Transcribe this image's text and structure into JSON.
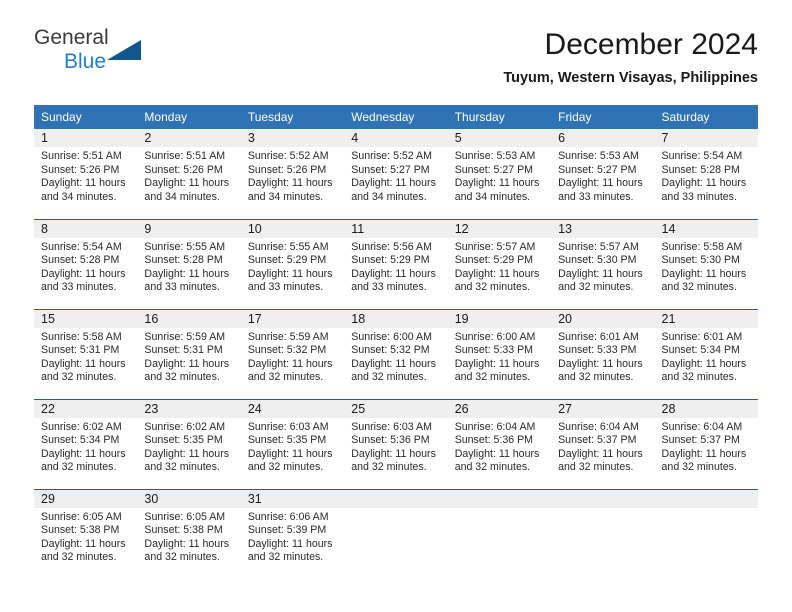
{
  "logo": {
    "word_top": "General",
    "word_bottom": "Blue",
    "triangle_color": "#11568f",
    "blue_color": "#1c7fd6"
  },
  "header": {
    "title": "December 2024",
    "subtitle": "Tuyum, Western Visayas, Philippines"
  },
  "theme": {
    "header_bg": "#2f73b4",
    "row_divider": "#1d5f9e",
    "daynum_bg": "#efefef"
  },
  "weekday_headers": [
    "Sunday",
    "Monday",
    "Tuesday",
    "Wednesday",
    "Thursday",
    "Friday",
    "Saturday"
  ],
  "weeks": [
    [
      {
        "day": "1",
        "sunrise": "Sunrise: 5:51 AM",
        "sunset": "Sunset: 5:26 PM",
        "daylight_line1": "Daylight: 11 hours",
        "daylight_line2": "and 34 minutes."
      },
      {
        "day": "2",
        "sunrise": "Sunrise: 5:51 AM",
        "sunset": "Sunset: 5:26 PM",
        "daylight_line1": "Daylight: 11 hours",
        "daylight_line2": "and 34 minutes."
      },
      {
        "day": "3",
        "sunrise": "Sunrise: 5:52 AM",
        "sunset": "Sunset: 5:26 PM",
        "daylight_line1": "Daylight: 11 hours",
        "daylight_line2": "and 34 minutes."
      },
      {
        "day": "4",
        "sunrise": "Sunrise: 5:52 AM",
        "sunset": "Sunset: 5:27 PM",
        "daylight_line1": "Daylight: 11 hours",
        "daylight_line2": "and 34 minutes."
      },
      {
        "day": "5",
        "sunrise": "Sunrise: 5:53 AM",
        "sunset": "Sunset: 5:27 PM",
        "daylight_line1": "Daylight: 11 hours",
        "daylight_line2": "and 34 minutes."
      },
      {
        "day": "6",
        "sunrise": "Sunrise: 5:53 AM",
        "sunset": "Sunset: 5:27 PM",
        "daylight_line1": "Daylight: 11 hours",
        "daylight_line2": "and 33 minutes."
      },
      {
        "day": "7",
        "sunrise": "Sunrise: 5:54 AM",
        "sunset": "Sunset: 5:28 PM",
        "daylight_line1": "Daylight: 11 hours",
        "daylight_line2": "and 33 minutes."
      }
    ],
    [
      {
        "day": "8",
        "sunrise": "Sunrise: 5:54 AM",
        "sunset": "Sunset: 5:28 PM",
        "daylight_line1": "Daylight: 11 hours",
        "daylight_line2": "and 33 minutes."
      },
      {
        "day": "9",
        "sunrise": "Sunrise: 5:55 AM",
        "sunset": "Sunset: 5:28 PM",
        "daylight_line1": "Daylight: 11 hours",
        "daylight_line2": "and 33 minutes."
      },
      {
        "day": "10",
        "sunrise": "Sunrise: 5:55 AM",
        "sunset": "Sunset: 5:29 PM",
        "daylight_line1": "Daylight: 11 hours",
        "daylight_line2": "and 33 minutes."
      },
      {
        "day": "11",
        "sunrise": "Sunrise: 5:56 AM",
        "sunset": "Sunset: 5:29 PM",
        "daylight_line1": "Daylight: 11 hours",
        "daylight_line2": "and 33 minutes."
      },
      {
        "day": "12",
        "sunrise": "Sunrise: 5:57 AM",
        "sunset": "Sunset: 5:29 PM",
        "daylight_line1": "Daylight: 11 hours",
        "daylight_line2": "and 32 minutes."
      },
      {
        "day": "13",
        "sunrise": "Sunrise: 5:57 AM",
        "sunset": "Sunset: 5:30 PM",
        "daylight_line1": "Daylight: 11 hours",
        "daylight_line2": "and 32 minutes."
      },
      {
        "day": "14",
        "sunrise": "Sunrise: 5:58 AM",
        "sunset": "Sunset: 5:30 PM",
        "daylight_line1": "Daylight: 11 hours",
        "daylight_line2": "and 32 minutes."
      }
    ],
    [
      {
        "day": "15",
        "sunrise": "Sunrise: 5:58 AM",
        "sunset": "Sunset: 5:31 PM",
        "daylight_line1": "Daylight: 11 hours",
        "daylight_line2": "and 32 minutes."
      },
      {
        "day": "16",
        "sunrise": "Sunrise: 5:59 AM",
        "sunset": "Sunset: 5:31 PM",
        "daylight_line1": "Daylight: 11 hours",
        "daylight_line2": "and 32 minutes."
      },
      {
        "day": "17",
        "sunrise": "Sunrise: 5:59 AM",
        "sunset": "Sunset: 5:32 PM",
        "daylight_line1": "Daylight: 11 hours",
        "daylight_line2": "and 32 minutes."
      },
      {
        "day": "18",
        "sunrise": "Sunrise: 6:00 AM",
        "sunset": "Sunset: 5:32 PM",
        "daylight_line1": "Daylight: 11 hours",
        "daylight_line2": "and 32 minutes."
      },
      {
        "day": "19",
        "sunrise": "Sunrise: 6:00 AM",
        "sunset": "Sunset: 5:33 PM",
        "daylight_line1": "Daylight: 11 hours",
        "daylight_line2": "and 32 minutes."
      },
      {
        "day": "20",
        "sunrise": "Sunrise: 6:01 AM",
        "sunset": "Sunset: 5:33 PM",
        "daylight_line1": "Daylight: 11 hours",
        "daylight_line2": "and 32 minutes."
      },
      {
        "day": "21",
        "sunrise": "Sunrise: 6:01 AM",
        "sunset": "Sunset: 5:34 PM",
        "daylight_line1": "Daylight: 11 hours",
        "daylight_line2": "and 32 minutes."
      }
    ],
    [
      {
        "day": "22",
        "sunrise": "Sunrise: 6:02 AM",
        "sunset": "Sunset: 5:34 PM",
        "daylight_line1": "Daylight: 11 hours",
        "daylight_line2": "and 32 minutes."
      },
      {
        "day": "23",
        "sunrise": "Sunrise: 6:02 AM",
        "sunset": "Sunset: 5:35 PM",
        "daylight_line1": "Daylight: 11 hours",
        "daylight_line2": "and 32 minutes."
      },
      {
        "day": "24",
        "sunrise": "Sunrise: 6:03 AM",
        "sunset": "Sunset: 5:35 PM",
        "daylight_line1": "Daylight: 11 hours",
        "daylight_line2": "and 32 minutes."
      },
      {
        "day": "25",
        "sunrise": "Sunrise: 6:03 AM",
        "sunset": "Sunset: 5:36 PM",
        "daylight_line1": "Daylight: 11 hours",
        "daylight_line2": "and 32 minutes."
      },
      {
        "day": "26",
        "sunrise": "Sunrise: 6:04 AM",
        "sunset": "Sunset: 5:36 PM",
        "daylight_line1": "Daylight: 11 hours",
        "daylight_line2": "and 32 minutes."
      },
      {
        "day": "27",
        "sunrise": "Sunrise: 6:04 AM",
        "sunset": "Sunset: 5:37 PM",
        "daylight_line1": "Daylight: 11 hours",
        "daylight_line2": "and 32 minutes."
      },
      {
        "day": "28",
        "sunrise": "Sunrise: 6:04 AM",
        "sunset": "Sunset: 5:37 PM",
        "daylight_line1": "Daylight: 11 hours",
        "daylight_line2": "and 32 minutes."
      }
    ],
    [
      {
        "day": "29",
        "sunrise": "Sunrise: 6:05 AM",
        "sunset": "Sunset: 5:38 PM",
        "daylight_line1": "Daylight: 11 hours",
        "daylight_line2": "and 32 minutes."
      },
      {
        "day": "30",
        "sunrise": "Sunrise: 6:05 AM",
        "sunset": "Sunset: 5:38 PM",
        "daylight_line1": "Daylight: 11 hours",
        "daylight_line2": "and 32 minutes."
      },
      {
        "day": "31",
        "sunrise": "Sunrise: 6:06 AM",
        "sunset": "Sunset: 5:39 PM",
        "daylight_line1": "Daylight: 11 hours",
        "daylight_line2": "and 32 minutes."
      },
      {
        "day": "",
        "sunrise": "",
        "sunset": "",
        "daylight_line1": "",
        "daylight_line2": ""
      },
      {
        "day": "",
        "sunrise": "",
        "sunset": "",
        "daylight_line1": "",
        "daylight_line2": ""
      },
      {
        "day": "",
        "sunrise": "",
        "sunset": "",
        "daylight_line1": "",
        "daylight_line2": ""
      },
      {
        "day": "",
        "sunrise": "",
        "sunset": "",
        "daylight_line1": "",
        "daylight_line2": ""
      }
    ]
  ]
}
